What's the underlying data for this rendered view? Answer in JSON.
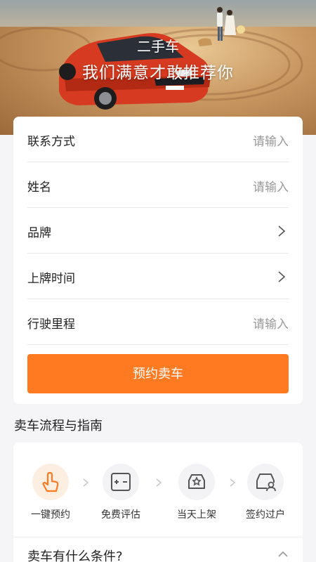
{
  "hero": {
    "subtitle": "二手车",
    "title": "我们满意才敢推荐你"
  },
  "form": {
    "rows": [
      {
        "label": "联系方式",
        "value": "请输入",
        "kind": "input"
      },
      {
        "label": "姓名",
        "value": "请输入",
        "kind": "input"
      },
      {
        "label": "品牌",
        "value": "",
        "kind": "select"
      },
      {
        "label": "上牌时间",
        "value": "",
        "kind": "select"
      },
      {
        "label": "行驶里程",
        "value": "请输入",
        "kind": "input"
      }
    ],
    "submit_label": "预约卖车"
  },
  "guide": {
    "title": "卖车流程与指南",
    "steps": [
      {
        "label": "一键预约",
        "icon": "tap-hand-icon",
        "active": true
      },
      {
        "label": "免费评估",
        "icon": "calculator-icon",
        "active": false
      },
      {
        "label": "当天上架",
        "icon": "car-star-icon",
        "active": false
      },
      {
        "label": "签约过户",
        "icon": "car-user-icon",
        "active": false
      }
    ],
    "faq_question": "卖车有什么条件?"
  },
  "colors": {
    "accent": "#ff7a21",
    "placeholder": "#9a9a9a"
  }
}
